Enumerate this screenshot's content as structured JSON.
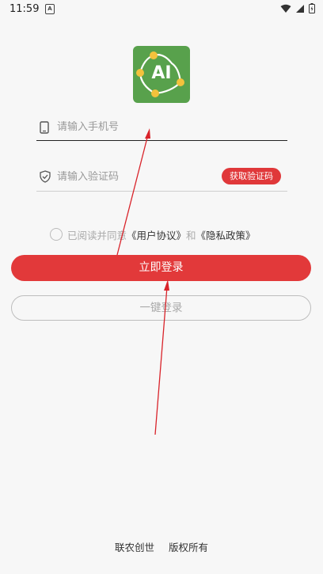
{
  "status_bar": {
    "time": "11:59",
    "notification_badge": "A",
    "icons": [
      "wifi-icon",
      "signal-icon",
      "battery-icon"
    ]
  },
  "logo": {
    "text": "AI",
    "bg_color": "#58a14c"
  },
  "phone_field": {
    "placeholder": "请输入手机号",
    "value": ""
  },
  "code_field": {
    "placeholder": "请输入验证码",
    "value": "",
    "get_code_label": "获取验证码"
  },
  "agreement": {
    "prefix": "已阅读并同意",
    "user_agreement": "《用户协议》",
    "conjunction": "和",
    "privacy_policy": "《隐私政策》",
    "checked": false
  },
  "login_button": "立即登录",
  "quick_login_button": "一键登录",
  "footer": {
    "company": "联农创世",
    "rights": "版权所有"
  },
  "colors": {
    "accent": "#e2393a",
    "logo_green": "#58a14c",
    "annotation_arrow": "#d9232a"
  }
}
